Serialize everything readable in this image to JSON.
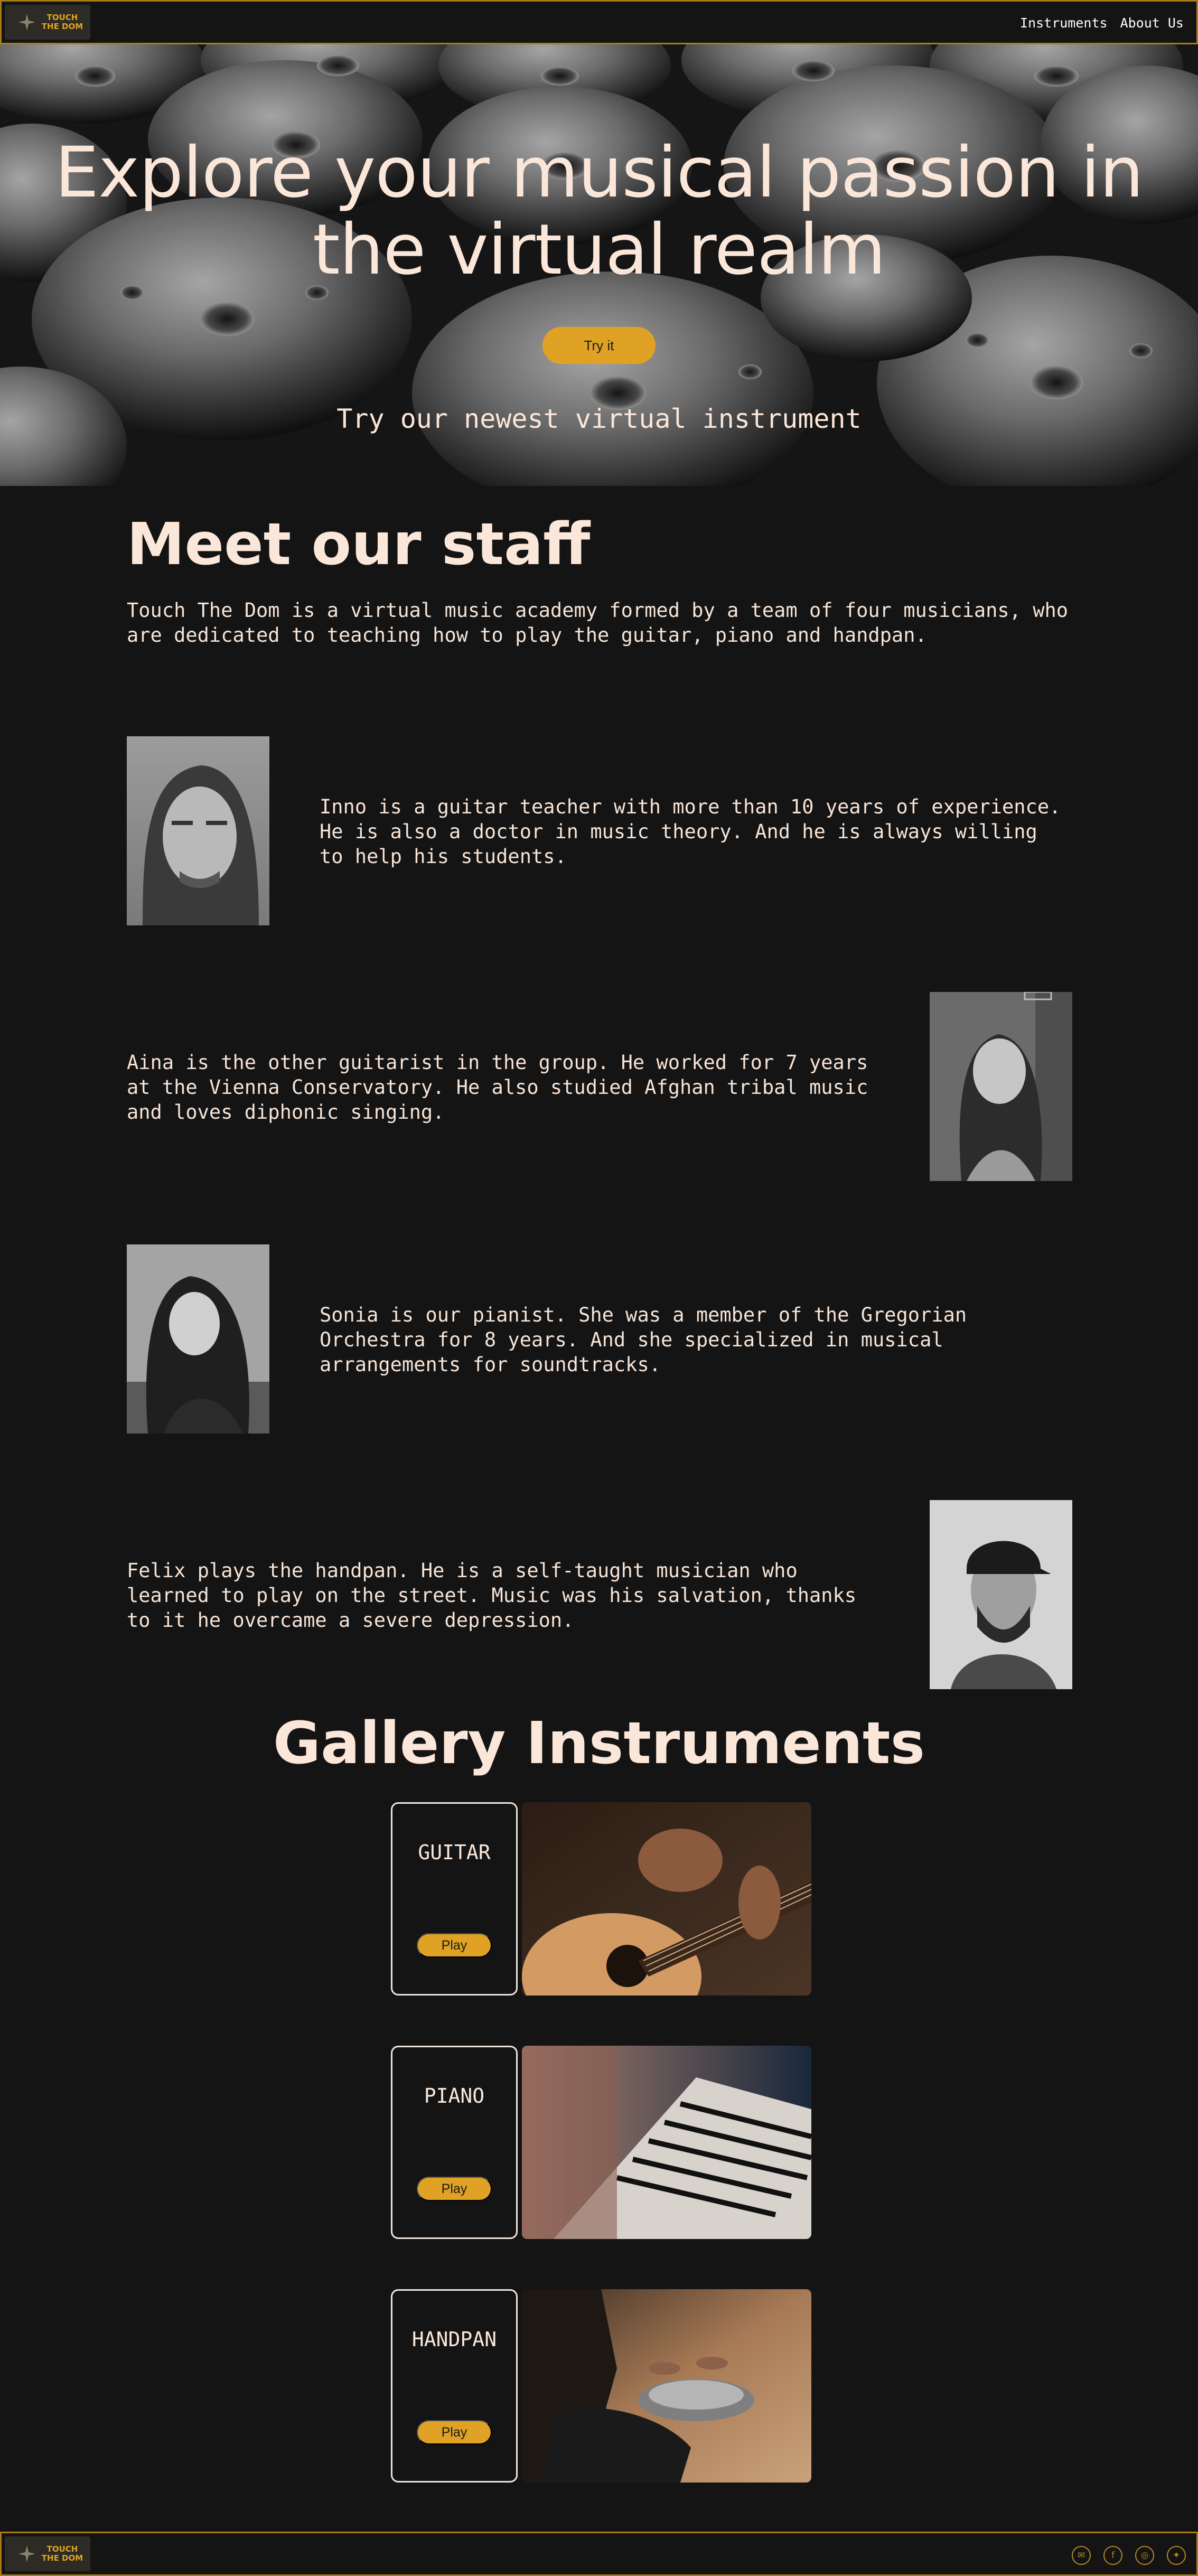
{
  "brand": {
    "logo_line1": "TOUCH",
    "logo_line2": "THE DOM"
  },
  "nav": {
    "instruments": "Instruments",
    "about": "About Us"
  },
  "hero": {
    "title": "Explore your musical passion in the virtual realm",
    "button": "Try it",
    "subtitle": "Try our newest virtual instrument"
  },
  "staff": {
    "title": "Meet our staff",
    "intro": "Touch The Dom is a virtual music academy formed by a team of four musicians, who are dedicated to teaching how to play the guitar, piano and handpan.",
    "members": [
      {
        "bio": "Inno is a guitar teacher with more than 10 years of experience. He is also a doctor in music theory. And he is always willing to help his students."
      },
      {
        "bio": "Aina is the other guitarist in the group. He worked for 7 years at the Vienna Conservatory. He also studied Afghan tribal music and loves diphonic singing."
      },
      {
        "bio": "Sonia is our pianist. She was a member of the Gregorian Orchestra for 8 years. And she specialized in musical arrangements for soundtracks."
      },
      {
        "bio": "Felix plays the handpan. He is a self-taught musician who learned to play on the street. Music was his salvation, thanks to it he overcame a severe depression."
      }
    ]
  },
  "gallery": {
    "title": "Gallery Instruments",
    "items": [
      {
        "name": "GUITAR",
        "button": "Play"
      },
      {
        "name": "PIANO",
        "button": "Play"
      },
      {
        "name": "HANDPAN",
        "button": "Play"
      }
    ]
  },
  "footer": {
    "social_icons": [
      "email-icon",
      "facebook-icon",
      "instagram-icon",
      "twitter-icon"
    ]
  },
  "colors": {
    "accent": "#e0a224",
    "border": "#a97c15",
    "background": "#141414",
    "text": "#fbe7d9"
  }
}
